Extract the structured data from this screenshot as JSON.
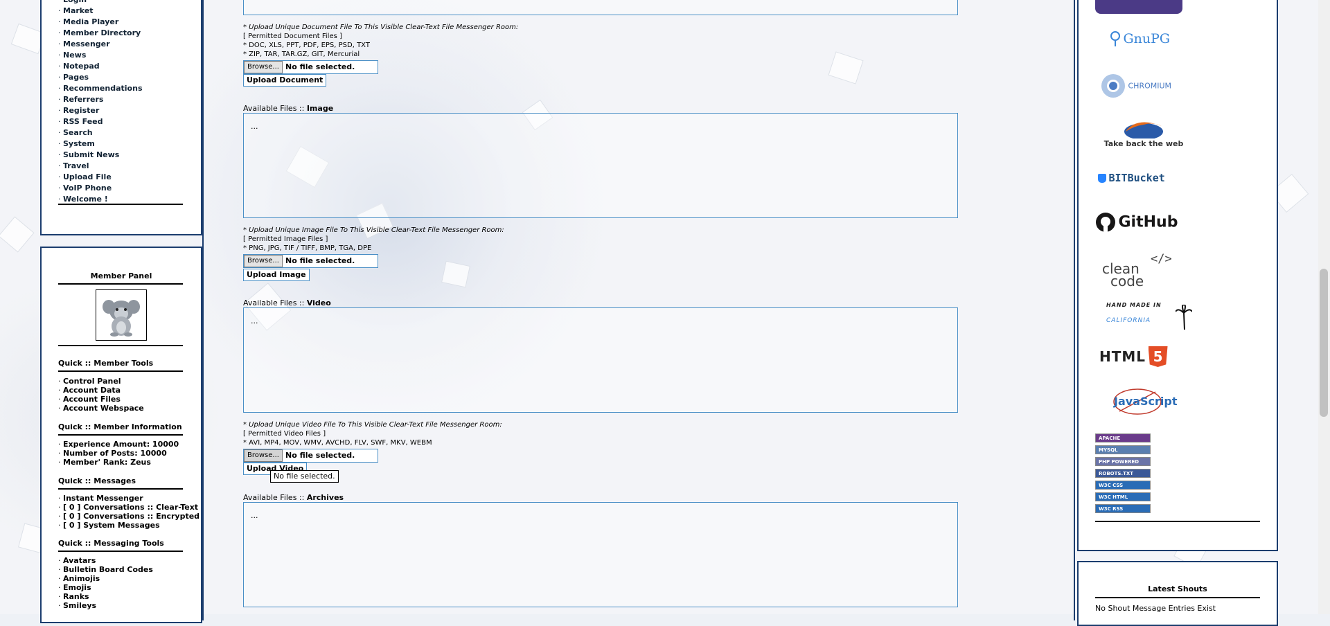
{
  "left_nav": {
    "items": [
      "Login",
      "Market",
      "Media Player",
      "Member Directory",
      "Messenger",
      "News",
      "Notepad",
      "Pages",
      "Recommendations",
      "Referrers",
      "Register",
      "RSS Feed",
      "Search",
      "System",
      "Submit News",
      "Travel",
      "Upload File",
      "VoIP Phone",
      "Welcome !"
    ]
  },
  "member_panel": {
    "title": "Member Panel",
    "tools_heading": "Quick :: Member Tools",
    "tools": [
      "Control Panel",
      "Account Data",
      "Account Files",
      "Account Webspace"
    ],
    "info_heading": "Quick :: Member Information",
    "info": [
      "Experience Amount: 10000",
      "Number of Posts: 10000",
      "Member' Rank: Zeus"
    ],
    "messages_heading": "Quick :: Messages",
    "messages": [
      "Instant Messenger",
      "[ 0 ] Conversations :: Clear-Text",
      "[ 0 ] Conversations :: Encrypted",
      "[ 0 ] System Messages"
    ],
    "messaging_tools_heading": "Quick :: Messaging Tools",
    "messaging_tools": [
      "Avatars",
      "Bulletin Board Codes",
      "Animojis",
      "Emojis",
      "Ranks",
      "Smileys"
    ]
  },
  "document_upload": {
    "title": "* Upload Unique Document File To This Visible Clear-Text File Messenger Room:",
    "permitted_label": "[ Permitted Document Files ]",
    "types_1": "* DOC, XLS, PPT, PDF, EPS, PSD, TXT",
    "types_2": "* ZIP, TAR, TAR.GZ, GIT, Mercurial",
    "browse_label": "Browse...",
    "no_file": "No file selected.",
    "button": "Upload Document"
  },
  "image_files": {
    "label": "Available Files :: ",
    "category": "Image",
    "content": "..."
  },
  "image_upload": {
    "title": "* Upload Unique Image File To This Visible Clear-Text File Messenger Room:",
    "permitted_label": "[ Permitted Image Files ]",
    "types_1": "* PNG, JPG, TIF / TIFF, BMP, TGA, DPE",
    "browse_label": "Browse...",
    "no_file": "No file selected.",
    "button": "Upload Image"
  },
  "video_files": {
    "label": "Available Files :: ",
    "category": "Video",
    "content": "..."
  },
  "video_upload": {
    "title": "* Upload Unique Video File To This Visible Clear-Text File Messenger Room:",
    "permitted_label": "[ Permitted Video Files ]",
    "types_1": "* AVI, MP4, MOV, WMV, AVCHD, FLV, SWF, MKV, WEBM",
    "browse_label": "Browse...",
    "no_file": "No file selected.",
    "button": "Upload Video",
    "tooltip": "No file selected."
  },
  "archive_files": {
    "label": "Available Files :: ",
    "category": "Archives",
    "content": "..."
  },
  "right_logos": {
    "gnupg": "GnuPG",
    "chromium": "CHROMIUM",
    "firefox": "Take back the web",
    "bitbucket": "BITBucket",
    "github": "GitHub",
    "cleancode_1": "clean",
    "cleancode_2": "code",
    "cleancode_tag": "</>",
    "handmade_1": "HAND MADE IN",
    "handmade_2": "CALIFORNIA",
    "html5": "HTML",
    "html5_num": "5",
    "javascript": "JavaScript",
    "badges": [
      "APACHE",
      "MYSQL",
      "PHP POWERED",
      "ROBOTS.TXT",
      "W3C CSS",
      "W3C HTML",
      "W3C RSS"
    ]
  },
  "latest_shouts": {
    "title": "Latest Shouts",
    "message": "No Shout Message Entries Exist"
  },
  "colors": {
    "border": "#1b3d6e",
    "field_border": "#4a8fc6"
  }
}
